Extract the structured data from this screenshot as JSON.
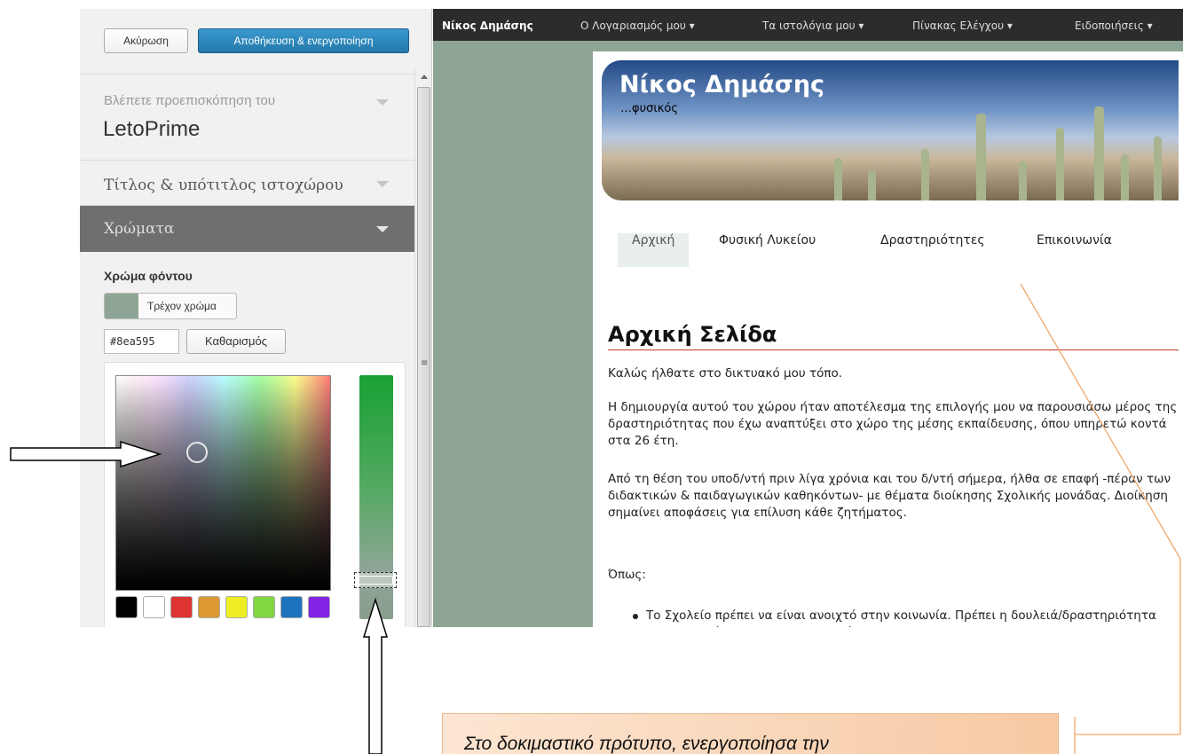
{
  "customizer": {
    "cancel_label": "Ακύρωση",
    "save_label": "Αποθήκευση & ενεργοποίηση",
    "preview_label": "Βλέπετε προεπισκόπηση του",
    "theme_name": "LetoPrime",
    "sections": [
      {
        "label": "Τίτλος & υπότιτλος ιστοχώρου",
        "active": false
      },
      {
        "label": "Χρώματα",
        "active": true
      }
    ],
    "background_color": {
      "title": "Χρώμα φόντου",
      "current_label": "Τρέχον χρώμα",
      "hex_value": "#8ea595",
      "clear_label": "Καθαρισμός",
      "swatch_color": "#8ea595",
      "palette": [
        "#000000",
        "#ffffff",
        "#dd3333",
        "#dd9933",
        "#eeee22",
        "#81d742",
        "#1e73be",
        "#8224e3"
      ]
    }
  },
  "preview": {
    "adminbar": {
      "site_name": "Νίκος Δημάσης",
      "items": [
        "Ο Λογαριασμός μου ▾",
        "Τα ιστολόγια μου ▾",
        "Πίνακας Ελέγχου ▾",
        "Ειδοποιήσεις ▾"
      ]
    },
    "site_title": "Νίκος Δημάσης",
    "site_tagline": "…φυσικός",
    "nav": [
      "Αρχική",
      "Φυσική Λυκείου",
      "Δραστηριότητες",
      "Επικοινωνία"
    ],
    "article": {
      "title": "Αρχική Σελίδα",
      "paragraphs": [
        "Καλώς ήλθατε στο δικτυακό μου τόπο.",
        "Η δημιουργία  αυτού του χώρου ήταν αποτέλεσμα  της επιλογής μου να παρουσιάσω μέρος της δραστηριότητας που έχω αναπτύξει στο χώρο της μέσης εκπαίδευσης, όπου υπηρετώ κοντά στα 26 έτη.",
        "Από τη θέση του υποδ/ντή πριν λίγα χρόνια και του δ/ντή σήμερα, ήλθα σε επαφή -πέραν των διδακτικών & παιδαγωγικών καθηκόντων- με θέματα διοίκησης Σχολικής μονάδας.  Διοίκηση σημαίνει αποφάσεις για επίλυση κάθε ζητήματος.",
        "Όπως:"
      ],
      "bullet": "Το Σχολείο πρέπει να είναι ανοιχτό στην κοινωνία. Πρέπει η δουλειά/δραστηριότητα των μαθητών μας και των συναδέλφων να"
    }
  },
  "annotation": {
    "callout_text": "Στο δοκιμαστικό πρότυπο, ενεργοποίησα την"
  }
}
